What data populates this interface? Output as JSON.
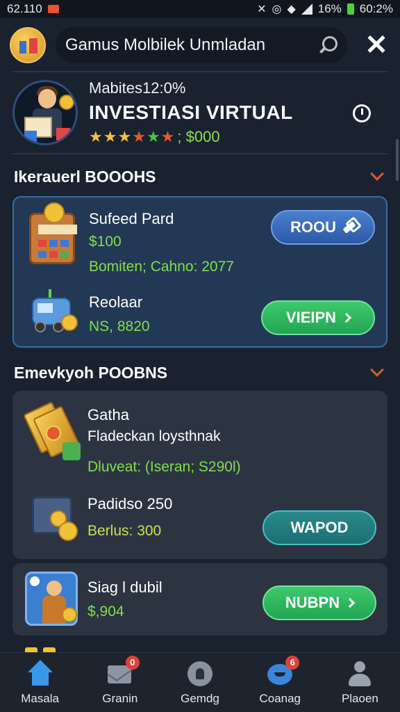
{
  "status_bar": {
    "time_left": "62.110",
    "battery": "16%",
    "clock": "60:2%"
  },
  "app_bar": {
    "title": "Gamus Molbilek Unmladan"
  },
  "profile": {
    "subtitle": "Mabites12:0%",
    "name": "INVESTIASI VIRTUAL",
    "rating_text": "; $000",
    "star_colors": [
      "#f4c33a",
      "#f4c33a",
      "#f4c33a",
      "#e65a2a",
      "#4cc04a",
      "#e65a2a"
    ]
  },
  "section1": {
    "title": "Ikerauerl BOOOHS",
    "items": [
      {
        "name": "Sufeed Pard",
        "value": "$100",
        "extra": "Bomiten; Cahno: 2077",
        "button": "ROOU"
      },
      {
        "name": "Reolaar",
        "value": "NS, 8820",
        "button": "VIEIPN"
      }
    ]
  },
  "section2": {
    "title": "Emevkyoh POOBNS",
    "items": [
      {
        "name": "Gatha",
        "desc": "Fladeckan loysthnak",
        "value": "Dluveat: (Iseran; S290l)"
      },
      {
        "name": "Padidso 250",
        "value": "Berlus: 300",
        "button": "WAPOD"
      }
    ]
  },
  "card3": {
    "name": "Siag l dubil",
    "value": "$,904",
    "button": "NUBPN"
  },
  "bottom_nav": [
    {
      "label": "Masala",
      "icon": "home-icon"
    },
    {
      "label": "Granin",
      "icon": "mail-icon",
      "badge": "0"
    },
    {
      "label": "Gemdg",
      "icon": "shield-icon"
    },
    {
      "label": "Coanag",
      "icon": "chat-icon",
      "badge": "6"
    },
    {
      "label": "Plaoen",
      "icon": "user-icon"
    }
  ]
}
